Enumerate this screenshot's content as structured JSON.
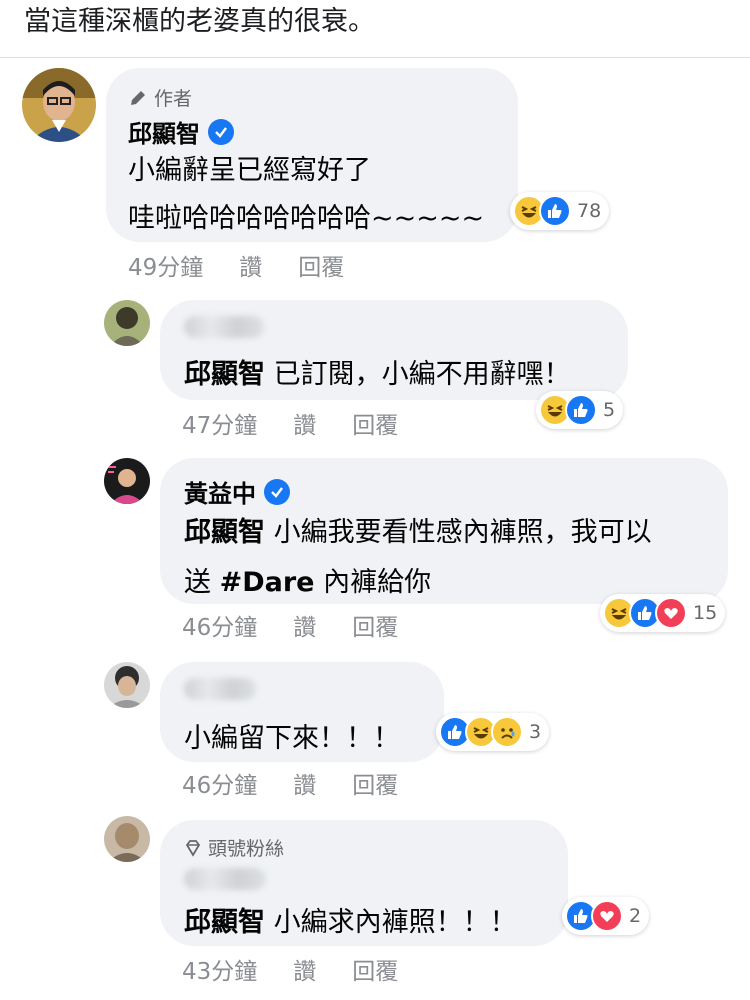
{
  "post_text": "當這種深櫃的老婆真的很衰。",
  "comments": [
    {
      "tag": "作者",
      "author": "邱顯智",
      "lines": [
        "小編辭呈已經寫好了",
        "哇啦哈哈哈哈哈哈哈~~~~~"
      ],
      "reaction_count": "78",
      "time": "49分鐘",
      "like": "讚",
      "reply": "回覆"
    },
    {
      "mention": "邱顯智",
      "text": " 已訂閱，小編不用辭嘿！",
      "reaction_count": "5",
      "time": "47分鐘",
      "like": "讚",
      "reply": "回覆"
    },
    {
      "author": "黃益中",
      "mention": "邱顯智",
      "line1": " 小編我要看性感內褲照，我可以",
      "line2_pre": "送 ",
      "hashtag": "#Dare",
      "line2_post": " 內褲給你",
      "reaction_count": "15",
      "time": "46分鐘",
      "like": "讚",
      "reply": "回覆"
    },
    {
      "text": "小編留下來！！！",
      "reaction_count": "3",
      "time": "46分鐘",
      "like": "讚",
      "reply": "回覆"
    },
    {
      "tag": "頭號粉絲",
      "mention": "邱顯智",
      "text": " 小編求內褲照！！！",
      "reaction_count": "2",
      "time": "43分鐘",
      "like": "讚",
      "reply": "回覆"
    }
  ],
  "colors": {
    "bubble": "#f0f2f5",
    "meta": "#8a8d91",
    "like": "#1877f2",
    "love": "#f33e58",
    "haha": "#f7c83b"
  }
}
